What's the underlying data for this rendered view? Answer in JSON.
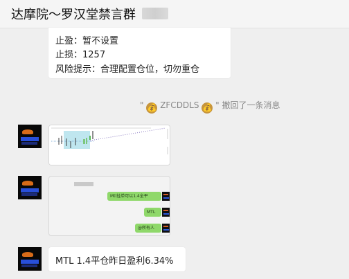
{
  "header": {
    "title": "达摩院～罗汉堂禁言群"
  },
  "messages": {
    "top_bubble": {
      "take_profit": "止盈：暂不设置",
      "stop_loss": "止损：1257",
      "risk": "风险提示：合理配置仓位，切勿重仓"
    },
    "recall_notice": {
      "quote_open": "\"",
      "user": "ZFCDDLS",
      "quote_close": "\"",
      "text": "撤回了一条消息"
    },
    "screenshot_bubbles": [
      "Mtl挂单可以1.4全平",
      "MTL",
      "@所有人"
    ],
    "final_message": "MTL  1.4平仓昨日盈利6.34%"
  },
  "icons": {
    "money_bag": "💰"
  },
  "colors": {
    "chat_background": "#efefef",
    "bubble_background": "#ffffff",
    "wechat_green": "#8fd86a",
    "avatar_black": "#080808"
  }
}
